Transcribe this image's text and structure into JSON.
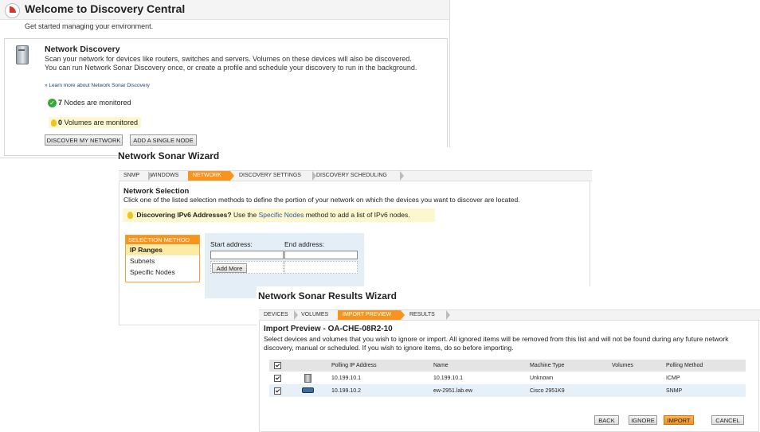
{
  "welcome": {
    "title": "Welcome to Discovery Central",
    "subtitle": "Get started managing your environment.",
    "network_discovery": {
      "title": "Network Discovery",
      "description": "Scan your network for devices like routers, switches and servers. Volumes on these devices will also be discovered. You can run Network Sonar Discovery once, or create a profile and schedule your discovery to run in the background.",
      "learn_more": "» Learn more about Network Sonar Discovery",
      "nodes_count": "7",
      "nodes_text": " Nodes are monitored",
      "volumes_count": "0",
      "volumes_text": " Volumes are monitored",
      "discover_button": "DISCOVER MY NETWORK",
      "add_node_button": "ADD A SINGLE NODE"
    }
  },
  "sonar_wizard": {
    "title": "Network Sonar Wizard",
    "steps": [
      "SNMP",
      "WINDOWS",
      "NETWORK",
      "DISCOVERY SETTINGS",
      "DISCOVERY SCHEDULING"
    ],
    "active_step": "NETWORK",
    "section_title": "Network Selection",
    "section_desc": "Click one of the listed selection methods to define the portion of your network on which the devices you want to discover are located.",
    "tip_bold": "Discovering IPv6 Addresses?",
    "tip_pre": " Use the ",
    "tip_link": "Specific Nodes",
    "tip_post": " method to add a list of IPv6 nodes.",
    "selection_header": "SELECTION METHOD",
    "methods": [
      "IP Ranges",
      "Subnets",
      "Specific Nodes"
    ],
    "active_method": "IP Ranges",
    "start_label": "Start address:",
    "end_label": "End address:",
    "start_value": "",
    "end_value": "",
    "add_more_button": "Add More"
  },
  "results_wizard": {
    "title": "Network Sonar Results Wizard",
    "steps": [
      "DEVICES",
      "VOLUMES",
      "IMPORT PREVIEW",
      "RESULTS"
    ],
    "active_step": "IMPORT PREVIEW",
    "preview_title": "Import Preview - OA-CHE-08R2-10",
    "preview_desc": "Select devices and volumes that you wish to ignore or import. All ignored items will be removed from this list and will not be found during any future network discovery, manual or scheduled. If you wish to ignore items, do so before importing.",
    "columns": [
      "Polling IP Address",
      "Name",
      "Machine Type",
      "Volumes",
      "Polling Method"
    ],
    "rows": [
      {
        "checked": true,
        "icon": "server-icon",
        "ip": "10.199.10.1",
        "name": "10.199.10.1",
        "machine_type": "Unknown",
        "volumes": "",
        "method": "ICMP"
      },
      {
        "checked": true,
        "icon": "router-icon",
        "ip": "10.199.10.2",
        "name": "ew-2951.lab.ew",
        "machine_type": "Cisco 2951K9",
        "volumes": "",
        "method": "SNMP"
      }
    ],
    "buttons": {
      "back": "BACK",
      "ignore": "IGNORE",
      "import": "IMPORT",
      "cancel": "CANCEL"
    }
  },
  "colors": {
    "accent": "#f7941d",
    "tip_bg": "#fdf7cf",
    "alt_row": "#e6f0f8",
    "ok_green": "#37a836"
  }
}
